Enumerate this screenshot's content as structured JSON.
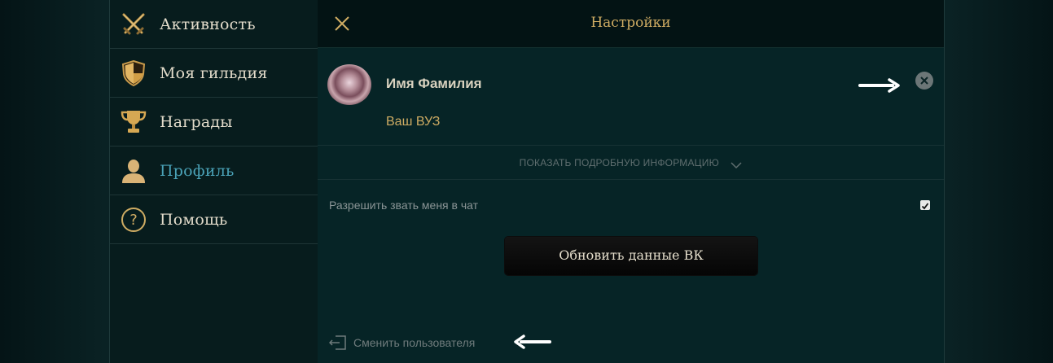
{
  "sidebar": {
    "items": [
      {
        "label": "Активность",
        "icon": "crossed-swords-icon",
        "active": false
      },
      {
        "label": "Моя гильдия",
        "icon": "shield-icon",
        "active": false
      },
      {
        "label": "Награды",
        "icon": "trophy-icon",
        "active": false
      },
      {
        "label": "Профиль",
        "icon": "user-icon",
        "active": true
      },
      {
        "label": "Помощь",
        "icon": "help-icon",
        "active": false
      }
    ]
  },
  "panel": {
    "title": "Настройки",
    "close_icon": "close-icon"
  },
  "profile": {
    "name": "Имя Фамилия",
    "university": "Ваш ВУЗ",
    "remove_icon": "remove-circle-icon"
  },
  "details": {
    "label": "ПОКАЗАТЬ ПОДРОБНУЮ ИНФОРМАЦИЮ"
  },
  "settings": {
    "allow_chat_label": "Разрешить звать меня в чат",
    "allow_chat_checked": true
  },
  "actions": {
    "update_vk_label": "Обновить данные ВК",
    "switch_user_label": "Сменить пользователя"
  },
  "colors": {
    "gold": "#cfac63",
    "active_blue": "#4aa2b7",
    "text_light": "#e3dccb"
  }
}
